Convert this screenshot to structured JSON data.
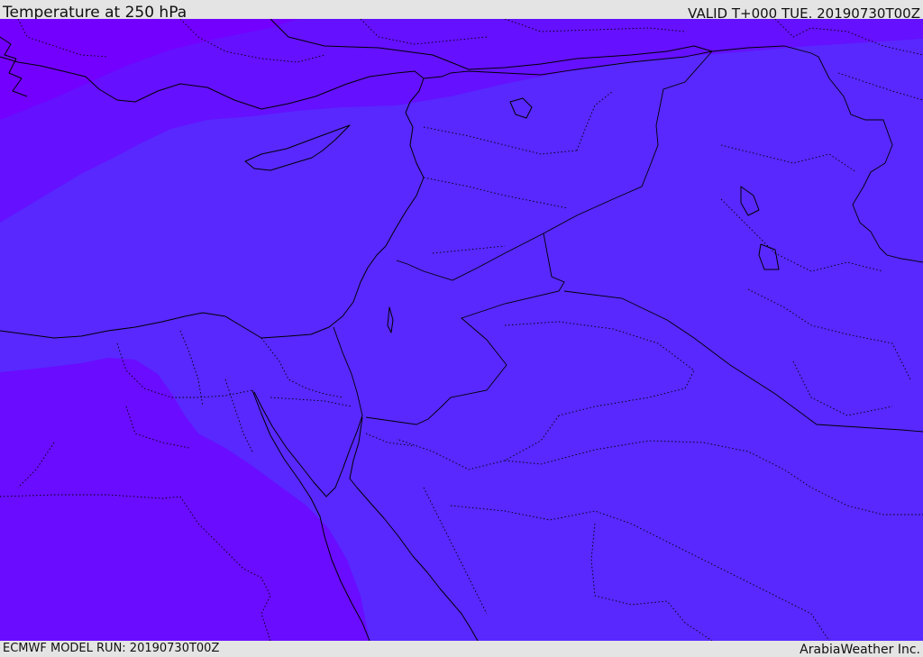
{
  "header": {
    "title": "Temperature at 250 hPa",
    "valid_time": "VALID T+000 TUE. 20190730T00Z"
  },
  "footer": {
    "model_run": "ECMWF MODEL RUN: 20190730T00Z",
    "credit": "ArabiaWeather Inc."
  },
  "colors": {
    "field_cold_band": "#7300ff",
    "field_mid_band": "#6510ff",
    "field_main": "#5828ff",
    "field_sw_band": "#6a0cff",
    "lines": "#000000",
    "bars": "#e4e4e4"
  }
}
